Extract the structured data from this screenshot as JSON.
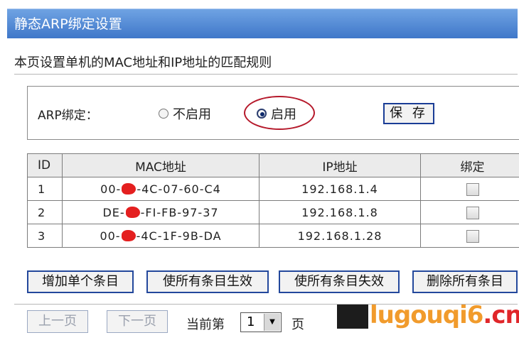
{
  "window": {
    "title": "静态ARP绑定设置"
  },
  "page": {
    "description": "本页设置单机的MAC地址和IP地址的匹配规则"
  },
  "arp_binding": {
    "label": "ARP绑定：",
    "option_off": "不启用",
    "option_on": "启用",
    "selected": "启用",
    "save_label": "保 存"
  },
  "table": {
    "headers": {
      "id": "ID",
      "mac": "MAC地址",
      "ip": "IP地址",
      "bind": "绑定"
    },
    "rows": [
      {
        "id": "1",
        "mac_prefix": "00-",
        "mac_suffix": "-4C-07-60-C4",
        "ip": "192.168.1.4",
        "bound": false
      },
      {
        "id": "2",
        "mac_prefix": "DE-",
        "mac_suffix": "-FI-FB-97-37",
        "ip": "192.168.1.8",
        "bound": false
      },
      {
        "id": "3",
        "mac_prefix": "00-",
        "mac_suffix": "-4C-1F-9B-DA",
        "ip": "192.168.1.28",
        "bound": false
      }
    ]
  },
  "actions": {
    "add_entry": "增加单个条目",
    "enable_all": "使所有条目生效",
    "disable_all": "使所有条目失效",
    "delete_all": "删除所有条目"
  },
  "pager": {
    "prev": "上一页",
    "next": "下一页",
    "current_label": "当前第",
    "page_value": "1",
    "page_suffix": "页"
  },
  "watermark": {
    "prefix": "lu",
    "mid": "gouqi6",
    "tail": ".cn"
  },
  "colors": {
    "title_bar": "#4a80d0",
    "button_border": "#23489c",
    "highlight": "#b5182a",
    "redaction": "#e41f1f"
  }
}
